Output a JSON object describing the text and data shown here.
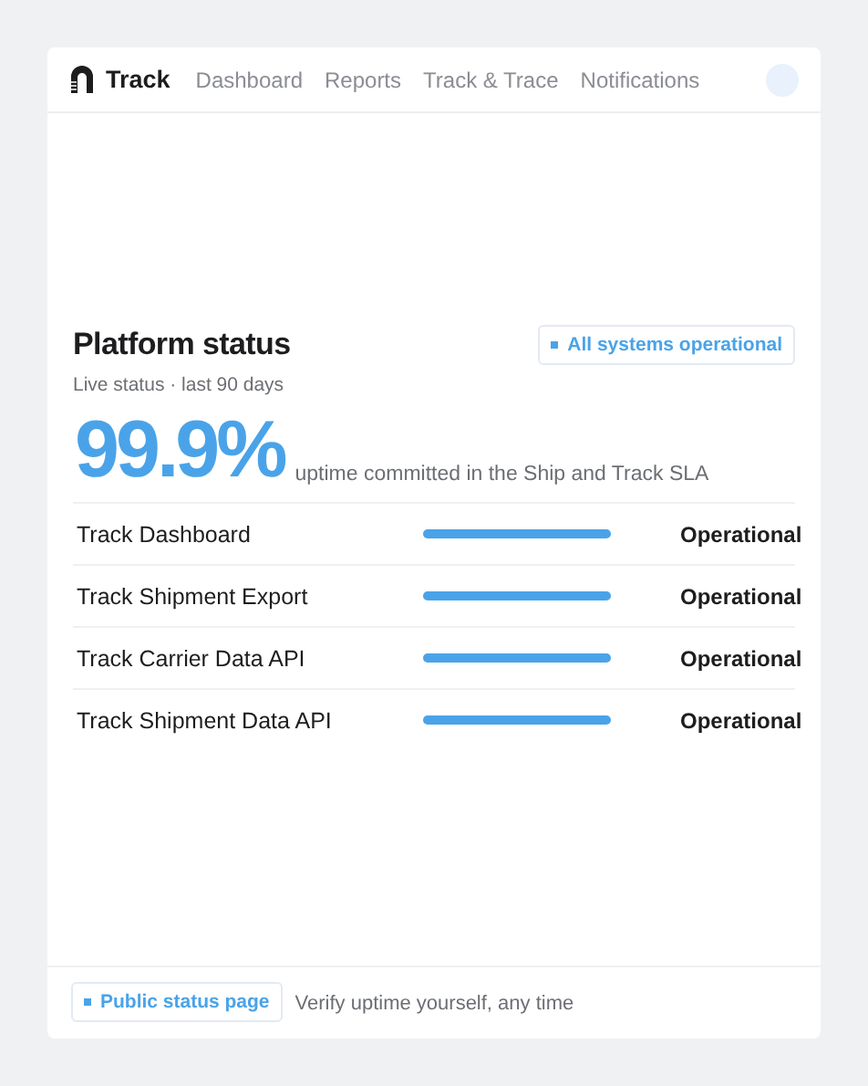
{
  "brand": "Track",
  "nav": [
    {
      "label": "Dashboard",
      "selected": false
    },
    {
      "label": "Reports",
      "selected": false
    },
    {
      "label": "Track & Trace",
      "selected": false
    },
    {
      "label": "Notifications",
      "selected": false
    }
  ],
  "title": "Platform status",
  "subtitle": "Live status · last 90 days",
  "badge": "All systems operational",
  "uptime": "99.9%",
  "uptime_caption": "uptime committed in the Ship and Track SLA",
  "services": [
    {
      "name": "Track Dashboard",
      "level": 1,
      "status": "Operational"
    },
    {
      "name": "Track Shipment Export",
      "level": 1,
      "status": "Operational"
    },
    {
      "name": "Track Carrier Data API",
      "level": 1,
      "status": "Operational"
    },
    {
      "name": "Track Shipment Data API",
      "level": 1,
      "status": "Operational"
    }
  ],
  "footer": {
    "link": "Public status page",
    "note": "Verify uptime yourself, any time"
  }
}
